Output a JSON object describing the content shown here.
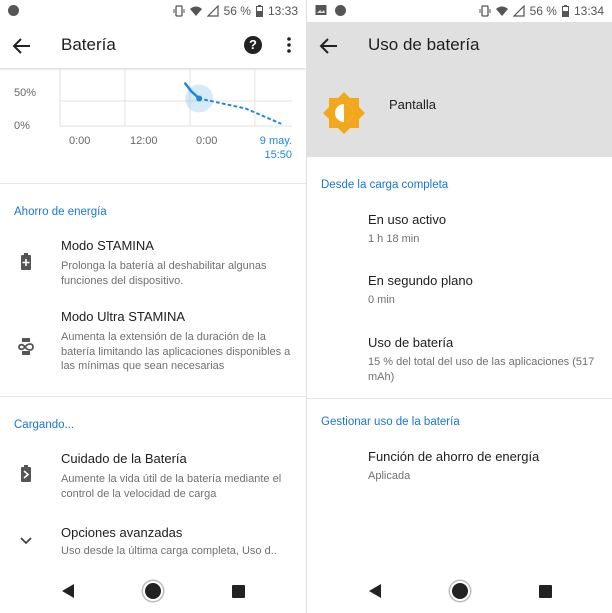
{
  "left": {
    "status": {
      "battery": "56 %",
      "time": "13:33"
    },
    "appbar": {
      "title": "Batería"
    },
    "chart_data": {
      "type": "line",
      "y_ticks": [
        "50%",
        "0%"
      ],
      "x_ticks": [
        "0:00",
        "12:00",
        "0:00"
      ],
      "x_end_label_1": "9 may.",
      "x_end_label_2": "15:50",
      "ylim": [
        0,
        100
      ],
      "series": [
        {
          "style": "solid",
          "x": [
            0.54,
            0.565,
            0.6
          ],
          "y": [
            85,
            70,
            55
          ]
        },
        {
          "style": "dotted",
          "x": [
            0.6,
            0.8,
            0.95
          ],
          "y": [
            55,
            35,
            5
          ]
        }
      ]
    },
    "sections": {
      "ahorro": "Ahorro de energía",
      "cargando": "Cargando..."
    },
    "items": {
      "stamina_title": "Modo STAMINA",
      "stamina_sub": "Prolonga la batería al deshabilitar algunas funciones del dispositivo.",
      "ultra_title": "Modo Ultra STAMINA",
      "ultra_sub": "Aumenta la extensión de la duración de la batería limitando las aplicaciones disponibles a las mínimas que sean necesarias",
      "cuidado_title": "Cuidado de la Batería",
      "cuidado_sub": "Aumente la vida útil de la batería mediante el control de la velocidad de carga",
      "avanzadas_title": "Opciones avanzadas",
      "avanzadas_sub": "Uso desde la última carga completa, Uso d.."
    }
  },
  "right": {
    "status": {
      "battery": "56 %",
      "time": "13:34"
    },
    "appbar": {
      "title": "Uso de batería"
    },
    "header": {
      "app_name": "Pantalla"
    },
    "sections": {
      "desde": "Desde la carga completa",
      "gestionar": "Gestionar uso de la batería"
    },
    "items": {
      "activo_title": "En uso activo",
      "activo_sub": "1 h 18 min",
      "segundo_title": "En segundo plano",
      "segundo_sub": "0 min",
      "uso_title": "Uso de batería",
      "uso_sub": "15 % del total del uso de las aplicaciones (517 mAh)",
      "funcion_title": "Función de ahorro de energía",
      "funcion_sub": "Aplicada"
    }
  },
  "colors": {
    "accent": "#1976d2",
    "chart_blue": "#1e88d8",
    "header_gray": "#e0e0e0"
  }
}
